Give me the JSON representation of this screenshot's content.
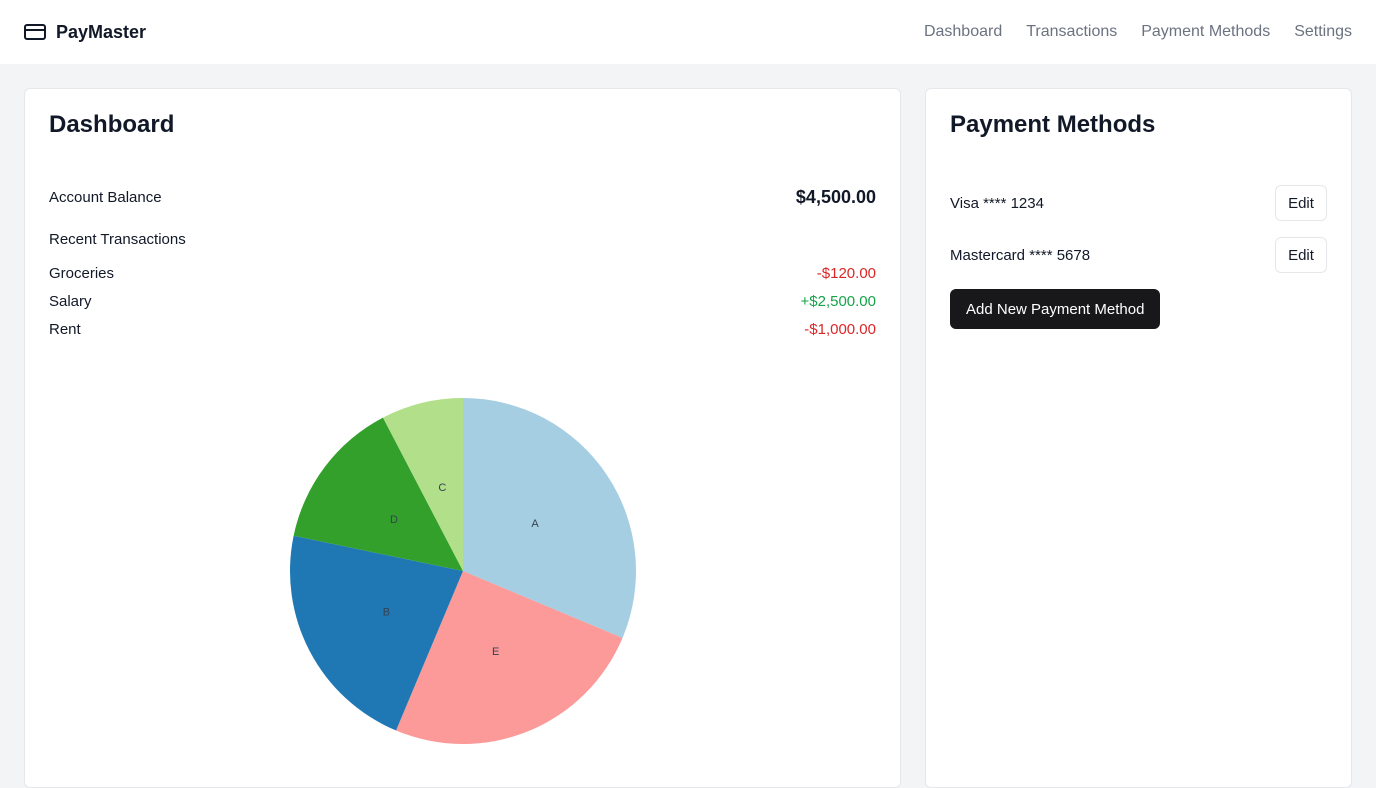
{
  "app": {
    "name": "PayMaster",
    "icon": "credit-card-icon"
  },
  "nav": [
    {
      "label": "Dashboard"
    },
    {
      "label": "Transactions"
    },
    {
      "label": "Payment Methods"
    },
    {
      "label": "Settings"
    }
  ],
  "dashboard": {
    "title": "Dashboard",
    "balance_label": "Account Balance",
    "balance_value": "$4,500.00",
    "recent_title": "Recent Transactions",
    "transactions": [
      {
        "name": "Groceries",
        "amount": "-$120.00",
        "kind": "debit"
      },
      {
        "name": "Salary",
        "amount": "+$2,500.00",
        "kind": "credit"
      },
      {
        "name": "Rent",
        "amount": "-$1,000.00",
        "kind": "debit"
      }
    ]
  },
  "payments": {
    "title": "Payment Methods",
    "methods": [
      {
        "label": "Visa **** 1234",
        "action": "Edit"
      },
      {
        "label": "Mastercard **** 5678",
        "action": "Edit"
      }
    ],
    "add_label": "Add New Payment Method"
  },
  "colors": {
    "negative": "#dc2626",
    "positive": "#16a34a",
    "primary_button": "#18181b"
  },
  "chart_data": {
    "type": "pie",
    "categories": [
      "A",
      "E",
      "B",
      "D",
      "C"
    ],
    "values": [
      30.7,
      24.5,
      21.5,
      13.8,
      7.5
    ],
    "colors": [
      "#a6cee3",
      "#fb9a99",
      "#1f78b4",
      "#33a02c",
      "#b2df8a"
    ],
    "title": "",
    "start_angle": "12 o'clock",
    "direction": "clockwise"
  }
}
